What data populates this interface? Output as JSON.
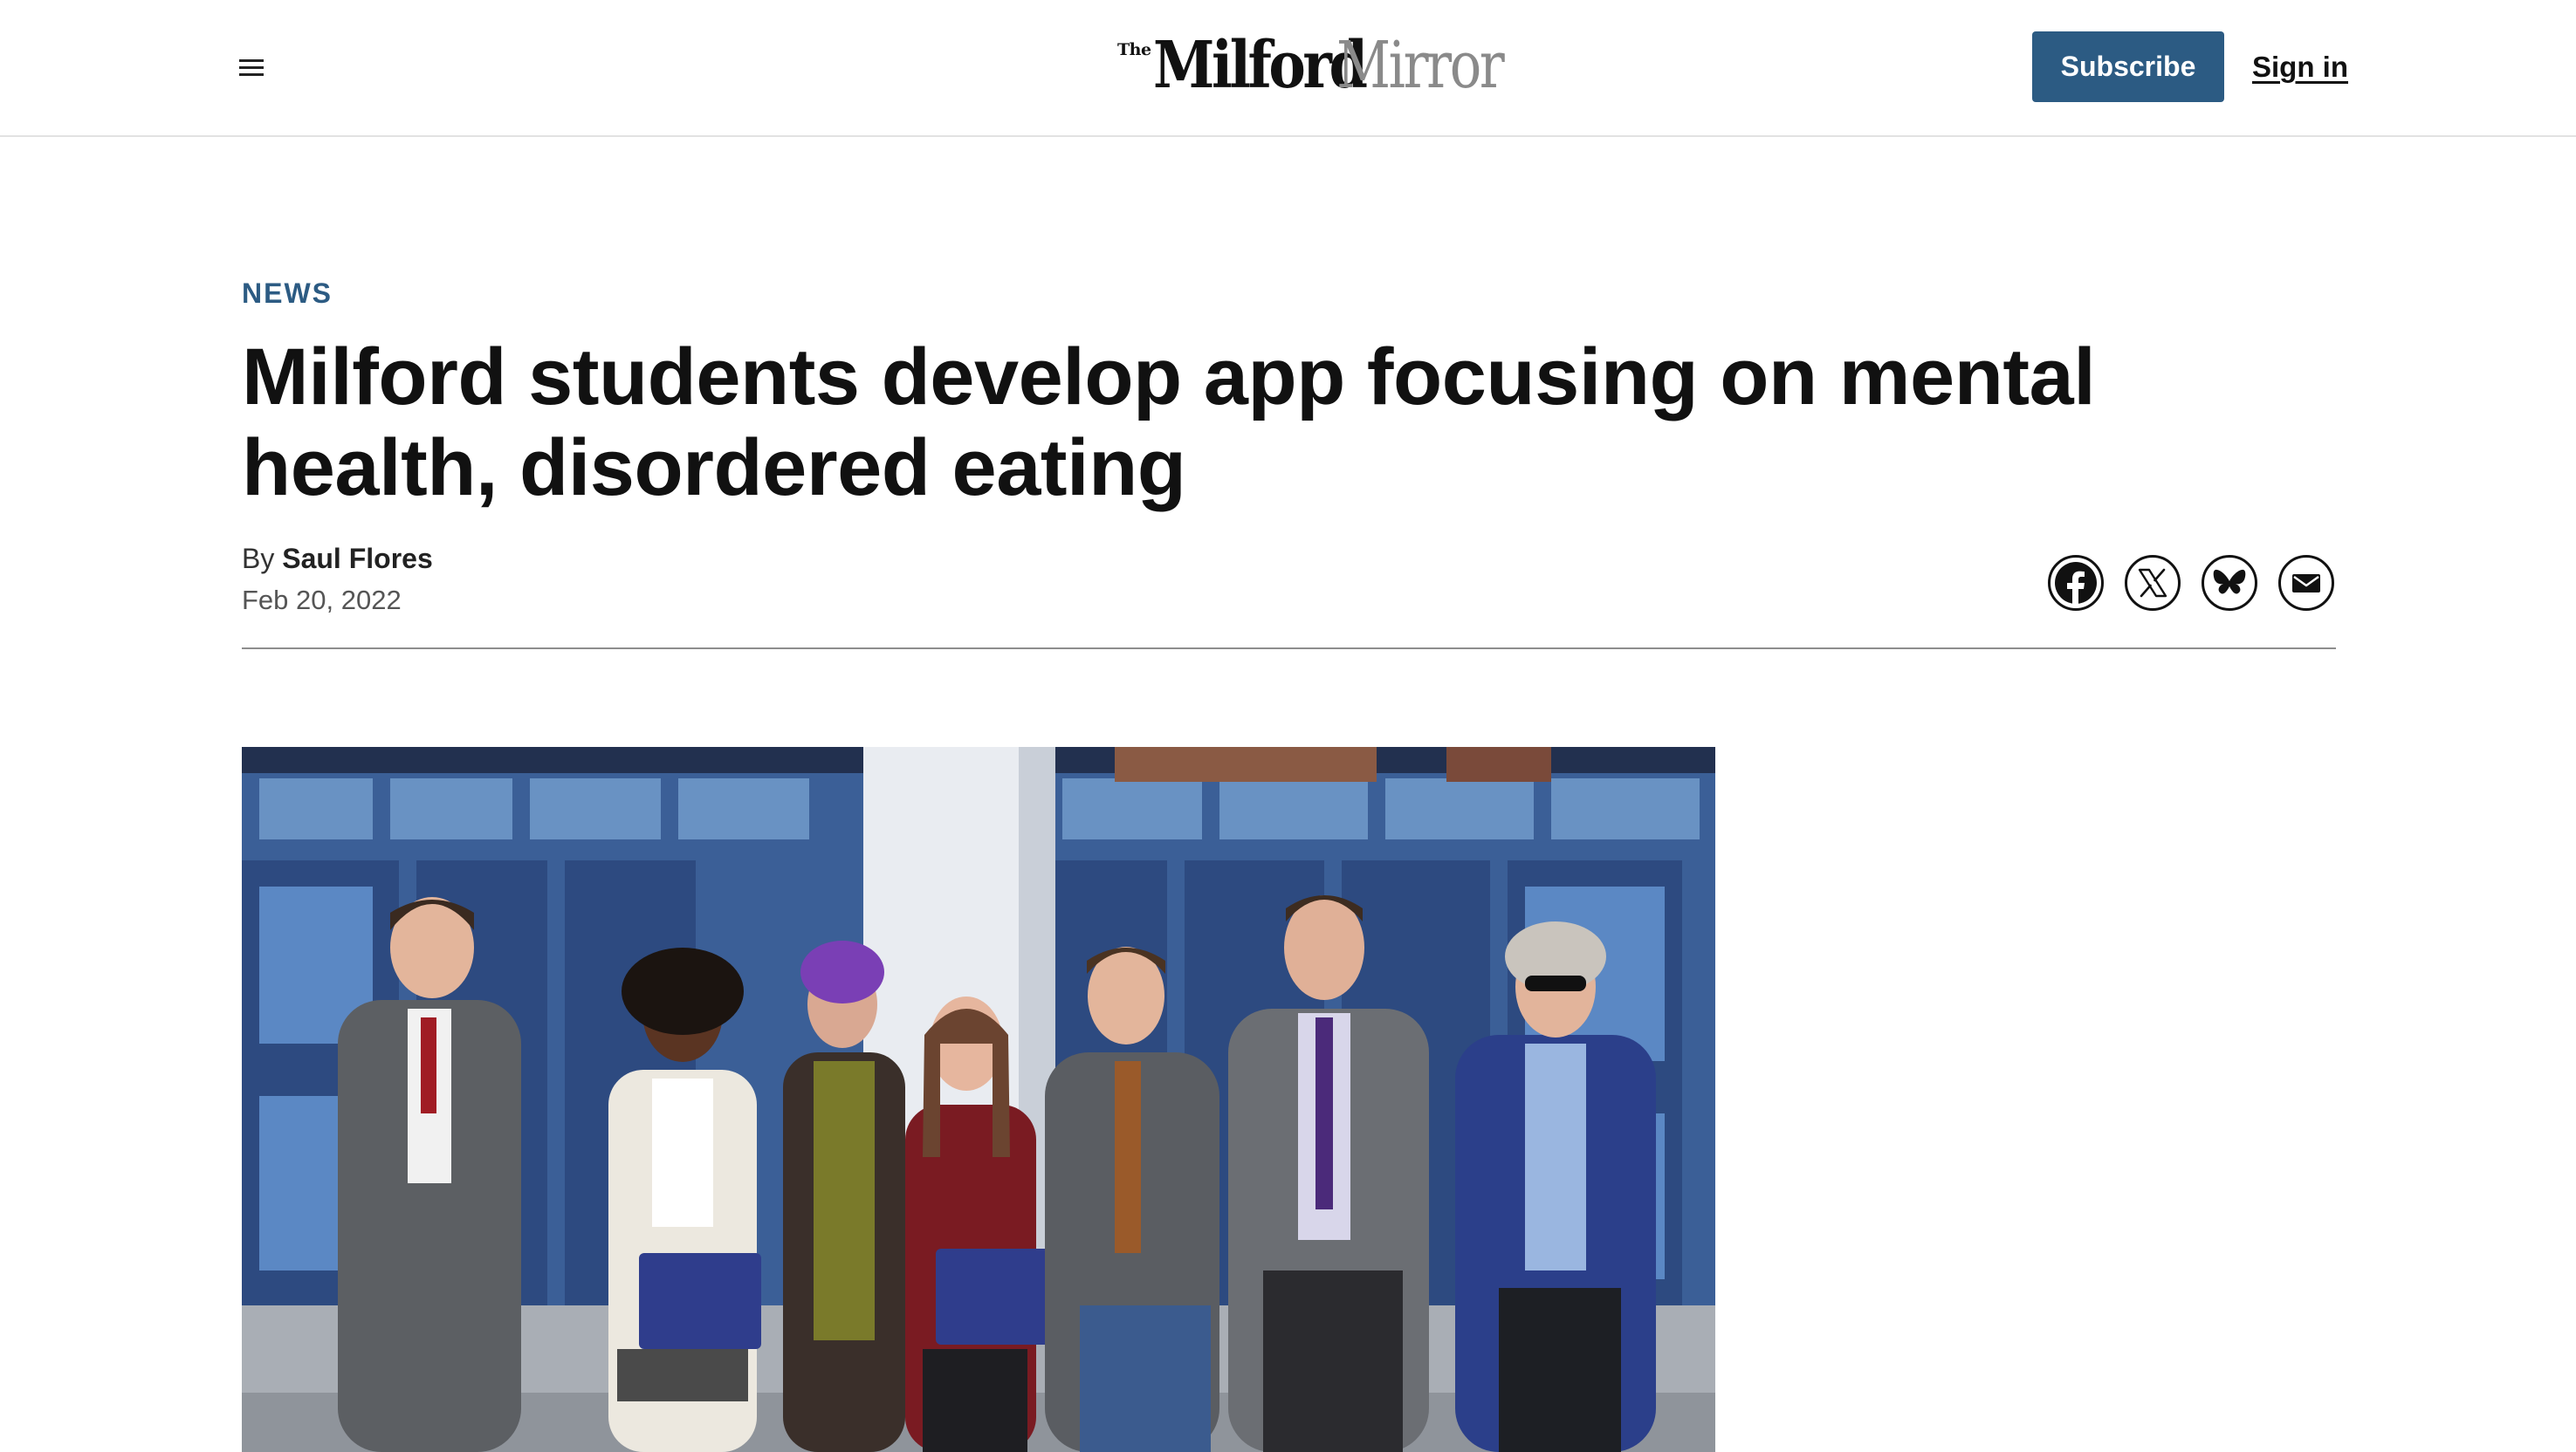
{
  "header": {
    "menu_icon": "hamburger-menu-icon",
    "logo": {
      "the": "The",
      "milford": "Milford",
      "mirror": "Mirror"
    },
    "subscribe_label": "Subscribe",
    "signin_label": "Sign in"
  },
  "article": {
    "section": "NEWS",
    "headline": "Milford students develop app focusing on mental health, disordered eating",
    "byline_prefix": "By",
    "author": "Saul Flores",
    "date": "Feb 20, 2022",
    "share_icons": [
      "facebook-icon",
      "x-icon",
      "bluesky-icon",
      "email-icon"
    ],
    "lead_photo_alt": "Group of seven people standing outside a school building, two holding certificate folders"
  },
  "colors": {
    "brand_blue": "#2c5b83",
    "text": "#111111",
    "logo_gray": "#8a8a8a",
    "divider": "#8e8e8e"
  }
}
